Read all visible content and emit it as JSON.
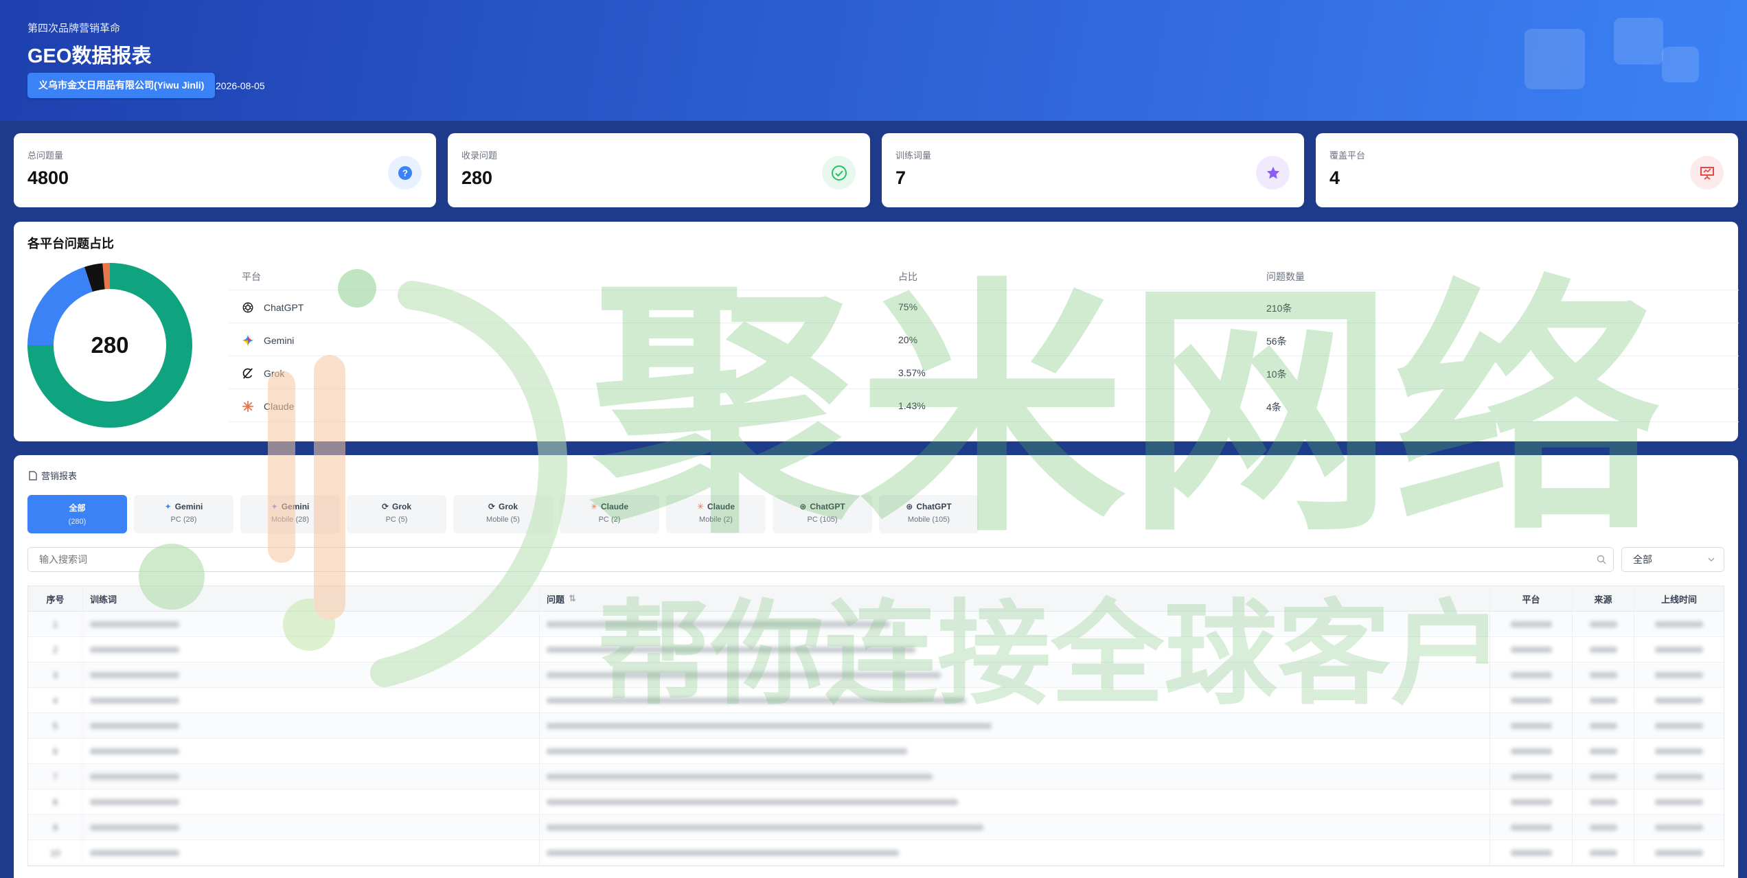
{
  "header": {
    "subtitle": "第四次品牌营销革命",
    "title": "GEO数据报表",
    "company": "义乌市金文日用品有限公司(Yiwu Jinli)",
    "date": "2026-08-05"
  },
  "stats": [
    {
      "label": "总问题量",
      "value": "4800",
      "icon": "question-icon",
      "color": "#3b82f6"
    },
    {
      "label": "收录问题",
      "value": "280",
      "icon": "check-circle-icon",
      "color": "#22c55e"
    },
    {
      "label": "训练词量",
      "value": "7",
      "icon": "star-icon",
      "color": "#8b5cf6"
    },
    {
      "label": "覆盖平台",
      "value": "4",
      "icon": "presentation-icon",
      "color": "#ef4444"
    }
  ],
  "platform_share": {
    "title": "各平台问题占比",
    "total": "280",
    "headers": {
      "platform": "平台",
      "share": "占比",
      "count": "问题数量"
    },
    "rows": [
      {
        "platform": "ChatGPT",
        "share": "75%",
        "count": "210条",
        "value": 210,
        "color": "#10a37f",
        "icon": "chatgpt-icon"
      },
      {
        "platform": "Gemini",
        "share": "20%",
        "count": "56条",
        "value": 56,
        "color": "#3b82f6",
        "icon": "gemini-icon"
      },
      {
        "platform": "Grok",
        "share": "3.57%",
        "count": "10条",
        "value": 10,
        "color": "#111111",
        "icon": "grok-icon"
      },
      {
        "platform": "Claude",
        "share": "1.43%",
        "count": "4条",
        "value": 4,
        "color": "#e8764a",
        "icon": "claude-icon"
      }
    ]
  },
  "report": {
    "title": "营销报表",
    "tabs": [
      {
        "name": "全部",
        "sub": "(280)",
        "active": true
      },
      {
        "name": "Gemini",
        "sub": "PC",
        "count": "(28)"
      },
      {
        "name": "Gemini",
        "sub": "Mobile",
        "count": "(28)"
      },
      {
        "name": "Grok",
        "sub": "PC",
        "count": "(5)"
      },
      {
        "name": "Grok",
        "sub": "Mobile",
        "count": "(5)"
      },
      {
        "name": "Claude",
        "sub": "PC",
        "count": "(2)"
      },
      {
        "name": "Claude",
        "sub": "Mobile",
        "count": "(2)"
      },
      {
        "name": "ChatGPT",
        "sub": "PC",
        "count": "(105)"
      },
      {
        "name": "ChatGPT",
        "sub": "Mobile",
        "count": "(105)"
      }
    ],
    "search_placeholder": "输入搜索词",
    "filter_value": "全部",
    "columns": [
      "序号",
      "训练词",
      "问题",
      "平台",
      "来源",
      "上线时间"
    ],
    "rows": [
      {
        "no": "1"
      },
      {
        "no": "2"
      },
      {
        "no": "3"
      },
      {
        "no": "4"
      },
      {
        "no": "5"
      },
      {
        "no": "6"
      },
      {
        "no": "7"
      },
      {
        "no": "8"
      },
      {
        "no": "9"
      },
      {
        "no": "10"
      }
    ]
  },
  "watermark": {
    "main": "聚米网络",
    "sub": "帮你连接全球客户"
  }
}
